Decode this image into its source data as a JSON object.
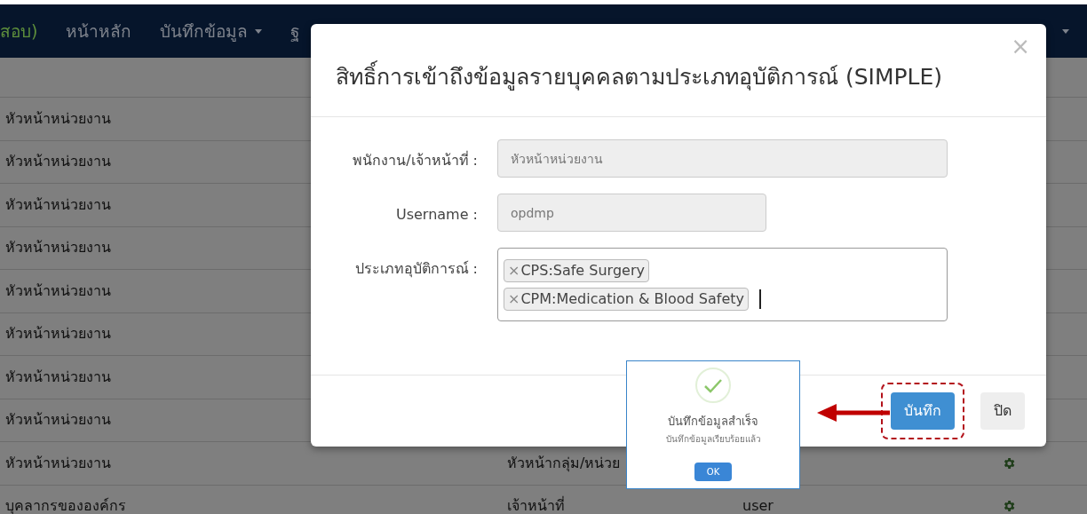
{
  "navbar": {
    "items": [
      {
        "label": "สอบ)",
        "kind": "brand"
      },
      {
        "label": "หน้าหลัก",
        "kind": "link"
      },
      {
        "label": "บันทึกข้อมูล",
        "kind": "dropdown"
      },
      {
        "label": "ฐ",
        "kind": "link"
      }
    ]
  },
  "table": {
    "rows": [
      {
        "cells": [
          "หัวหน้าหน่วยงาน"
        ]
      },
      {
        "cells": [
          "หัวหน้าหน่วยงาน"
        ]
      },
      {
        "cells": [
          "หัวหน้าหน่วยงาน"
        ]
      },
      {
        "cells": [
          "หัวหน้าหน่วยงาน"
        ]
      },
      {
        "cells": [
          "หัวหน้าหน่วยงาน"
        ]
      },
      {
        "cells": [
          "หัวหน้าหน่วยงาน"
        ]
      },
      {
        "cells": [
          "หัวหน้าหน่วยงาน"
        ]
      },
      {
        "cells": [
          "หัวหน้าหน่วยงาน"
        ]
      },
      {
        "cells": [
          "หัวหน้าหน่วยงาน",
          "หัวหน้ากลุ่ม/หน่วย"
        ],
        "gear": true
      },
      {
        "cells": [
          "บุคลากรขององค์กร",
          "เจ้าหน้าที่",
          "user"
        ],
        "gear": true
      }
    ]
  },
  "modal": {
    "title": "สิทธิ์การเข้าถึงข้อมูลรายบุคคลตามประเภทอุบัติการณ์ (SIMPLE)",
    "close": "×",
    "fields": [
      {
        "label": "พนักงาน/เจ้าหน้าที่ :",
        "kind": "text",
        "value": "หัวหน้าหน่วยงาน",
        "disabled": true
      },
      {
        "label": "Username :",
        "kind": "text",
        "value": "opdmp",
        "disabled": true
      },
      {
        "label": "ประเภทอุบัติการณ์ :",
        "kind": "tags",
        "tags": [
          {
            "remove": "×",
            "text": "CPS:Safe Surgery"
          },
          {
            "remove": "×",
            "text": "CPM:Medication & Blood Safety"
          }
        ]
      }
    ],
    "buttons": [
      {
        "label": "บันทึก",
        "kind": "primary",
        "highlighted": true
      },
      {
        "label": "ปิด",
        "kind": "default",
        "highlighted": false
      }
    ]
  },
  "alert": {
    "title": "บันทึกข้อมูลสำเร็จ",
    "message": "บันทึกข้อมูลเรียบร้อยแล้ว",
    "button": "OK"
  }
}
